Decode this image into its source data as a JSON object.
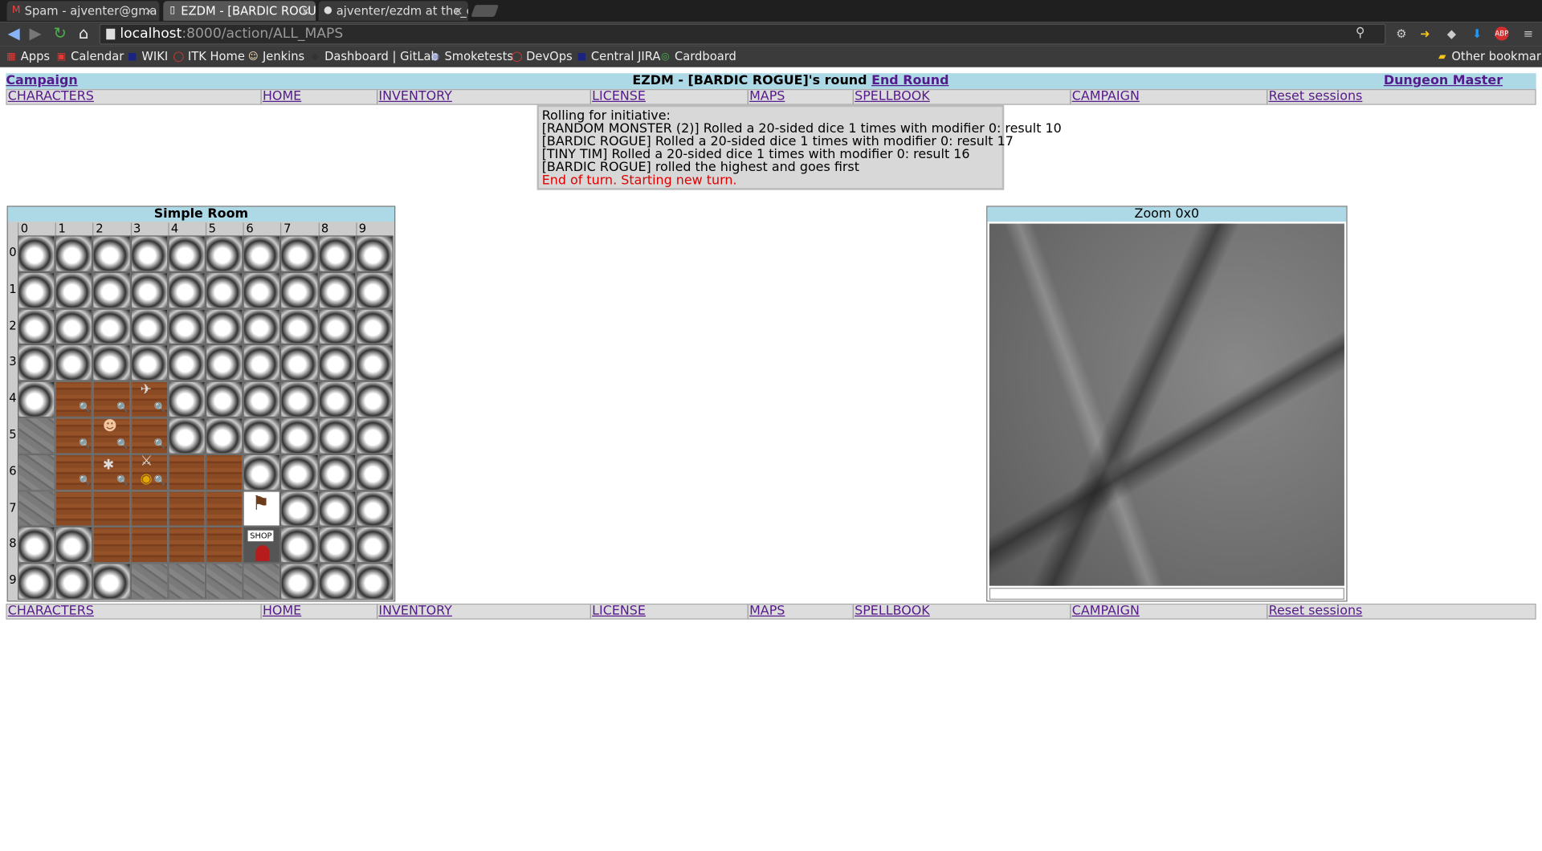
{
  "browser": {
    "tabs": [
      {
        "title": "Spam - ajventer@gma",
        "icon": "gmail-icon"
      },
      {
        "title": "EZDM - [BARDIC ROGU",
        "icon": "page-icon"
      },
      {
        "title": "ajventer/ezdm at the_c",
        "icon": "github-icon"
      }
    ],
    "url_host": "localhost",
    "url_rest": ":8000/action/ALL_MAPS",
    "bookmarks": [
      "Apps",
      "Calendar",
      "WIKI",
      "ITK Home",
      "Jenkins",
      "Dashboard | GitLab",
      "Smoketests",
      "DevOps",
      "Central JIRA",
      "Cardboard"
    ],
    "other_bookmarks": "Other bookmarks"
  },
  "header": {
    "campaign_link": "Campaign",
    "title": "EZDM - [BARDIC ROGUE]'s round",
    "end_round_link": "End Round",
    "dungeon_master_link": "Dungeon Master"
  },
  "menu": [
    "CHARACTERS",
    "HOME",
    "INVENTORY",
    "LICENSE",
    "MAPS",
    "SPELLBOOK",
    "CAMPAIGN",
    "Reset sessions"
  ],
  "log": [
    "Rolling for initiative:",
    "[RANDOM MONSTER (2)] Rolled a 20-sided dice 1 times with modifier 0: result 10",
    "[BARDIC ROGUE] Rolled a 20-sided dice 1 times with modifier 0: result 17",
    "[TINY TIM] Rolled a 20-sided dice 1 times with modifier 0: result 16",
    "[BARDIC ROGUE] rolled the highest and goes first"
  ],
  "log_status": "End of turn. Starting new turn.",
  "map": {
    "title": "Simple Room",
    "columns": [
      "0",
      "1",
      "2",
      "3",
      "4",
      "5",
      "6",
      "7",
      "8",
      "9"
    ],
    "rows": [
      "0",
      "1",
      "2",
      "3",
      "4",
      "5",
      "6",
      "7",
      "8",
      "9"
    ],
    "tiles": [
      "RRRRRRRRRR",
      "RRRRRRRRRR",
      "RRRRRRRRRR",
      "RRRRRRRRRR",
      "RWWWRRRRRR",
      "SWWWRRRRRR",
      "SWWWWWRRRR",
      "SWWWWWGRRR",
      "RRWWWWHRRR",
      "RRRSSSSRRR"
    ]
  },
  "zoom": {
    "title": "Zoom 0x0"
  }
}
